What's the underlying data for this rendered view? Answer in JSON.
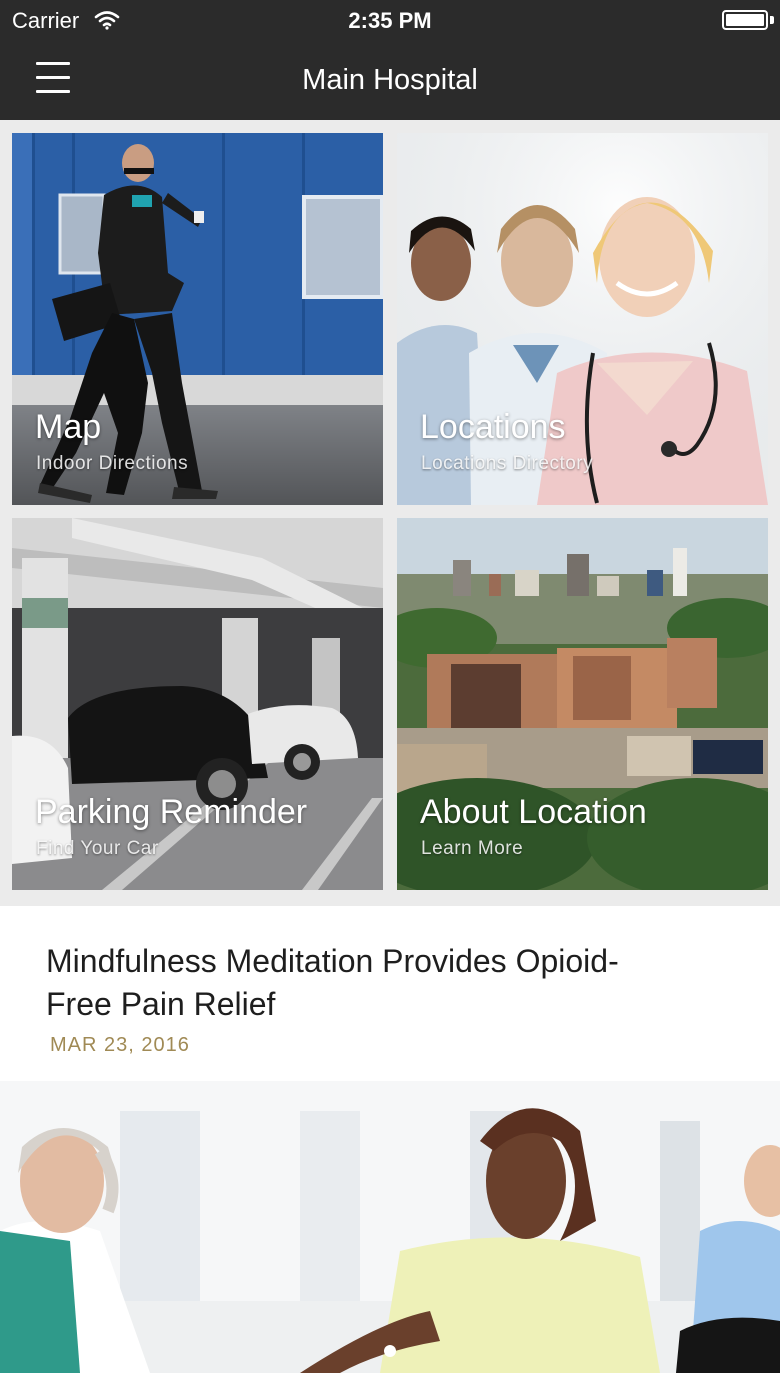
{
  "status_bar": {
    "carrier": "Carrier",
    "time": "2:35 PM",
    "wifi_icon": "wifi-icon",
    "battery_icon": "battery-icon"
  },
  "nav": {
    "title": "Main Hospital",
    "menu_icon": "hamburger-menu-icon"
  },
  "tiles": [
    {
      "title": "Map",
      "subtitle": "Indoor Directions"
    },
    {
      "title": "Locations",
      "subtitle": "Locations Directory"
    },
    {
      "title": "Parking Reminder",
      "subtitle": "Find Your Car"
    },
    {
      "title": "About Location",
      "subtitle": "Learn More"
    }
  ],
  "news": {
    "headline": "Mindfulness Meditation Provides Opioid-Free Pain Relief",
    "date": "MAR 23, 2016"
  },
  "pager": {
    "page_count": 1,
    "current_page": 1
  },
  "colors": {
    "nav_background": "#2b2b2b",
    "page_background": "#ebebeb",
    "date_accent": "#a08a55"
  }
}
